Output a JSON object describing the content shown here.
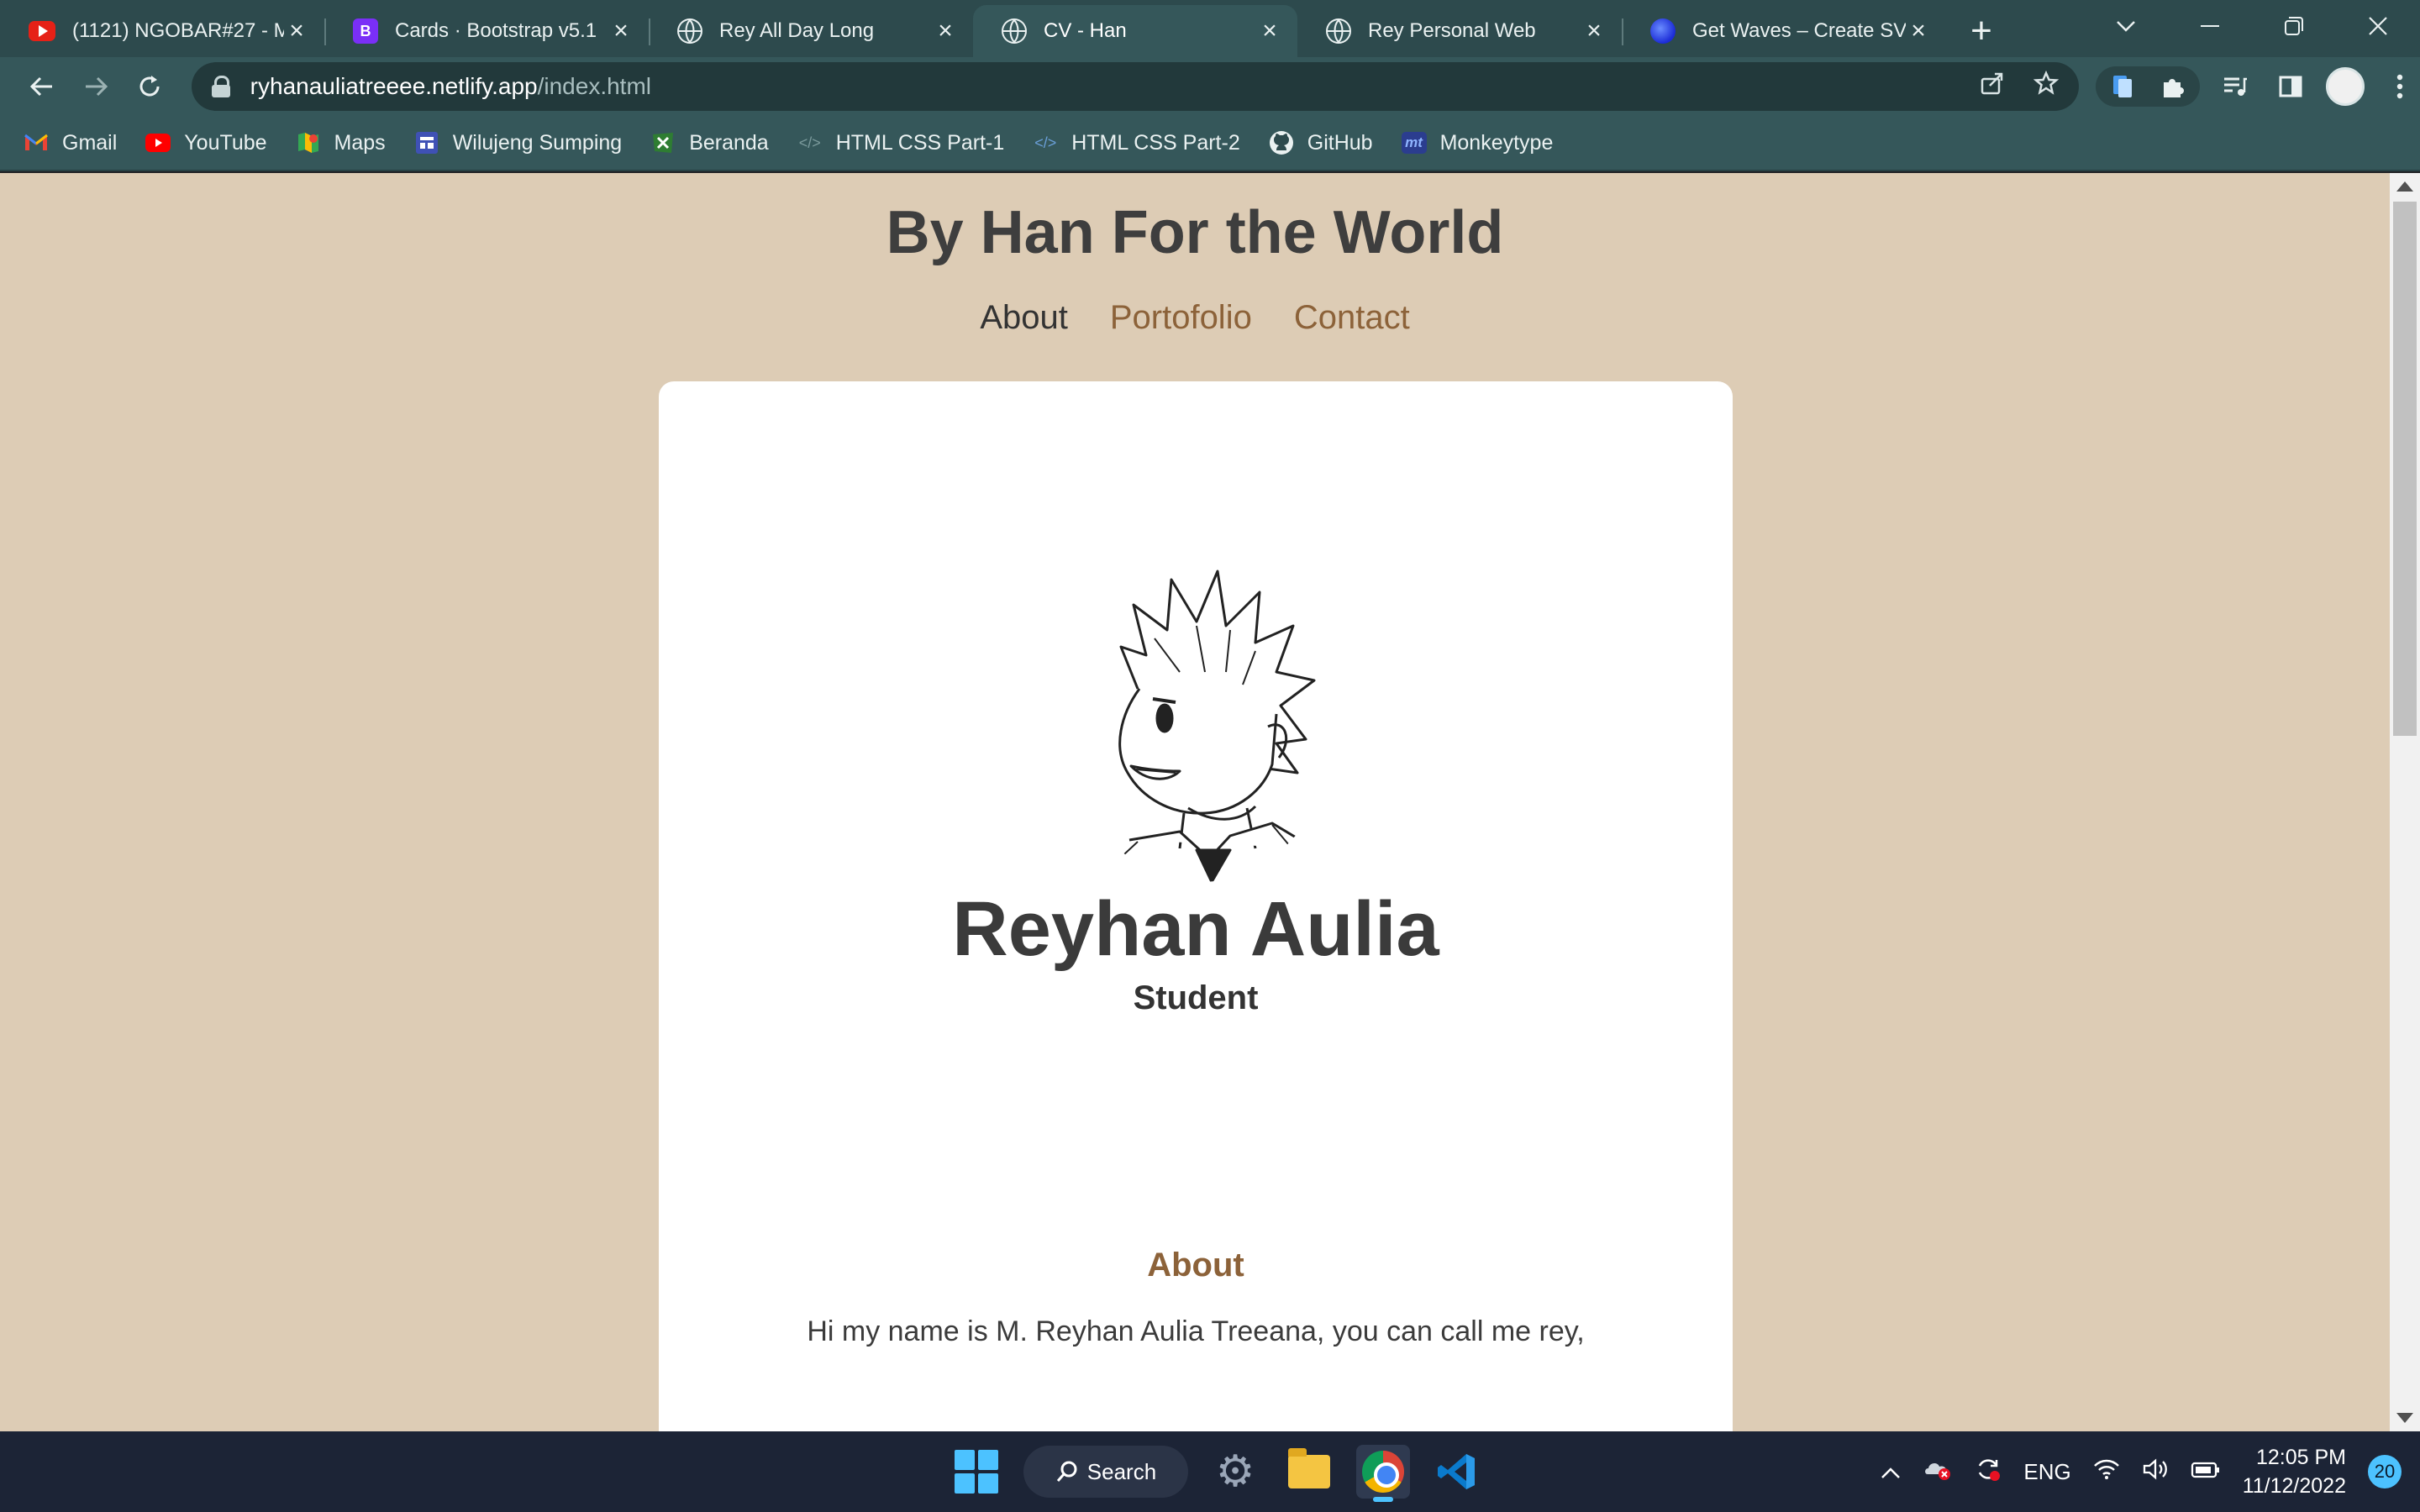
{
  "browser": {
    "tabs": [
      {
        "title": "(1121) NGOBAR#27 - M",
        "favicon": "youtube-icon",
        "active": false
      },
      {
        "title": "Cards · Bootstrap v5.1",
        "favicon": "bootstrap-icon",
        "favicon_text": "B",
        "active": false
      },
      {
        "title": "Rey All Day Long",
        "favicon": "globe-icon",
        "active": false
      },
      {
        "title": "CV - Han",
        "favicon": "globe-icon",
        "active": true
      },
      {
        "title": "Rey Personal Web",
        "favicon": "globe-icon",
        "active": false
      },
      {
        "title": "Get Waves – Create SVG",
        "favicon": "waves-icon",
        "active": false
      }
    ],
    "new_tab_label": "+",
    "url_host": "ryhanauliatreeee.netlify.app",
    "url_path": "/index.html",
    "bookmarks": [
      {
        "label": "Gmail",
        "icon": "gmail-icon"
      },
      {
        "label": "YouTube",
        "icon": "youtube-icon"
      },
      {
        "label": "Maps",
        "icon": "maps-icon"
      },
      {
        "label": "Wilujeng Sumping",
        "icon": "site-icon"
      },
      {
        "label": "Beranda",
        "icon": "sheets-icon"
      },
      {
        "label": "HTML CSS Part-1",
        "icon": "code-icon"
      },
      {
        "label": "HTML CSS Part-2",
        "icon": "code-icon"
      },
      {
        "label": "GitHub",
        "icon": "github-icon"
      },
      {
        "label": "Monkeytype",
        "icon": "monkeytype-icon",
        "icon_text": "mt"
      }
    ]
  },
  "page": {
    "site_title": "By Han For the World",
    "nav": [
      {
        "label": "About",
        "current": true
      },
      {
        "label": "Portofolio",
        "current": false
      },
      {
        "label": "Contact",
        "current": false
      }
    ],
    "profile": {
      "name": "Reyhan Aulia",
      "role": "Student"
    },
    "about": {
      "heading": "About",
      "text": "Hi my name is M. Reyhan Aulia Treeana, you can call me rey,"
    },
    "colors": {
      "background": "#ddccb5",
      "accent": "#8c6239",
      "text": "#3e3e3e"
    }
  },
  "taskbar": {
    "search_label": "Search",
    "language": "ENG",
    "time": "12:05 PM",
    "date": "11/12/2022",
    "notifications": "20"
  }
}
